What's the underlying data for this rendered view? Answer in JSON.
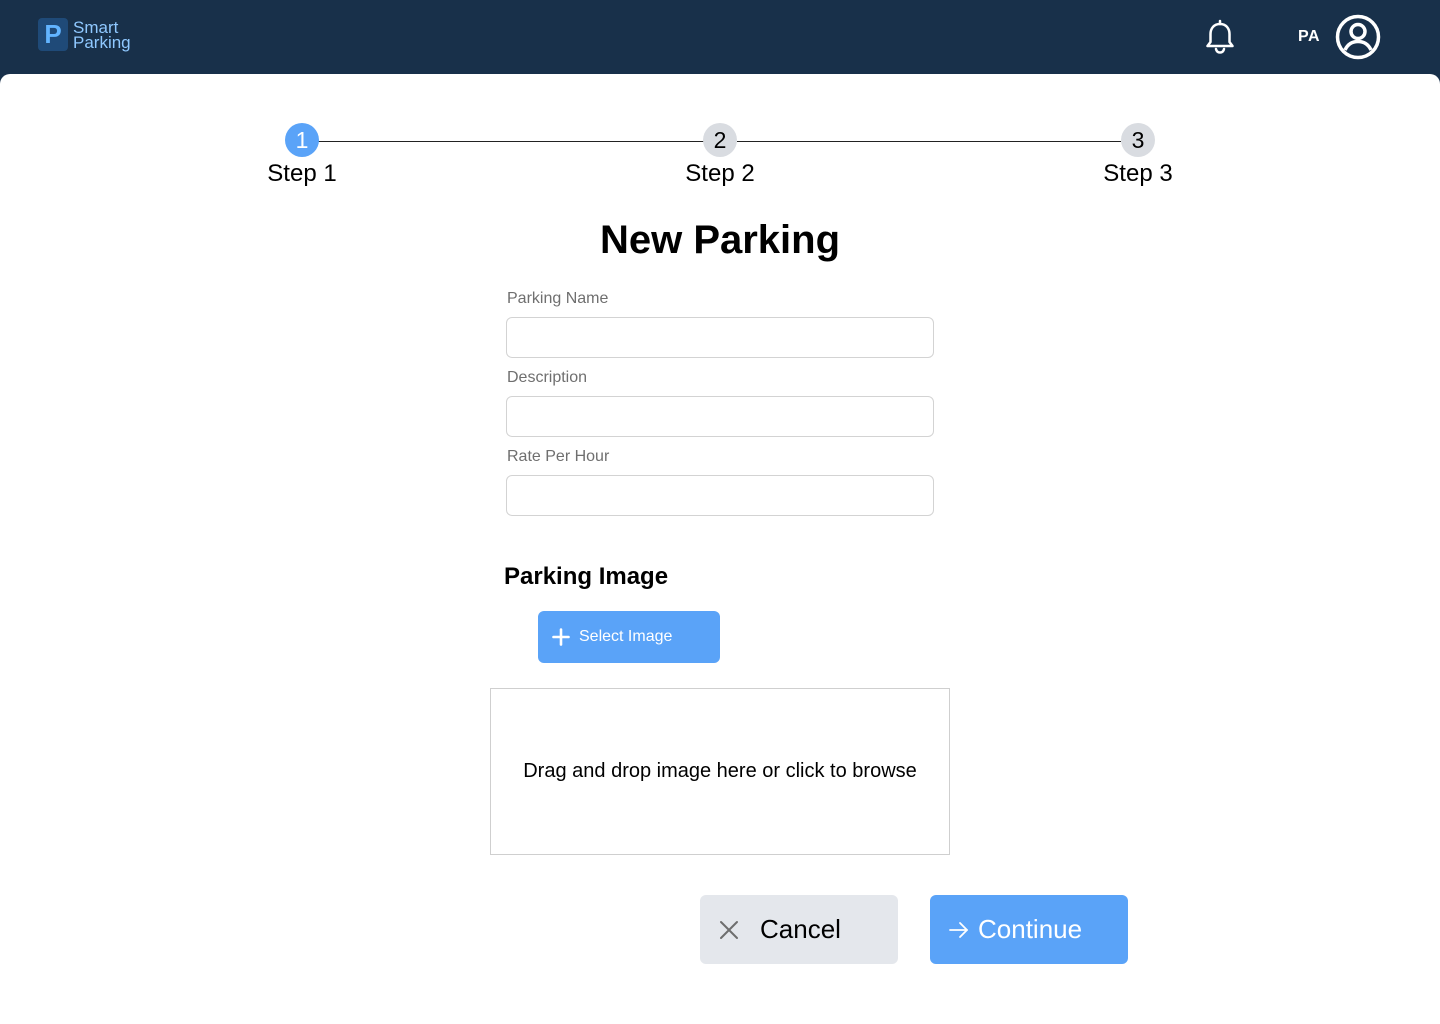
{
  "header": {
    "logo_letter": "P",
    "logo_line1": "Smart",
    "logo_line2": "Parking",
    "user_initials": "PA"
  },
  "stepper": {
    "steps": [
      {
        "number": "1",
        "label": "Step 1",
        "state": "active"
      },
      {
        "number": "2",
        "label": "Step 2",
        "state": "inactive"
      },
      {
        "number": "3",
        "label": "Step 3",
        "state": "inactive"
      }
    ]
  },
  "form": {
    "title": "New Parking",
    "parking_name_label": "Parking Name",
    "parking_name_value": "",
    "description_label": "Description",
    "description_value": "",
    "rate_label": "Rate Per Hour",
    "rate_value": "",
    "image_section_title": "Parking Image",
    "select_image_label": "Select Image",
    "dropzone_text": "Drag and drop image here or click to browse",
    "cancel_label": "Cancel",
    "continue_label": "Continue"
  },
  "colors": {
    "header_bg": "#18304a",
    "accent": "#5aa3f8",
    "secondary_button": "#e4e7ec"
  }
}
